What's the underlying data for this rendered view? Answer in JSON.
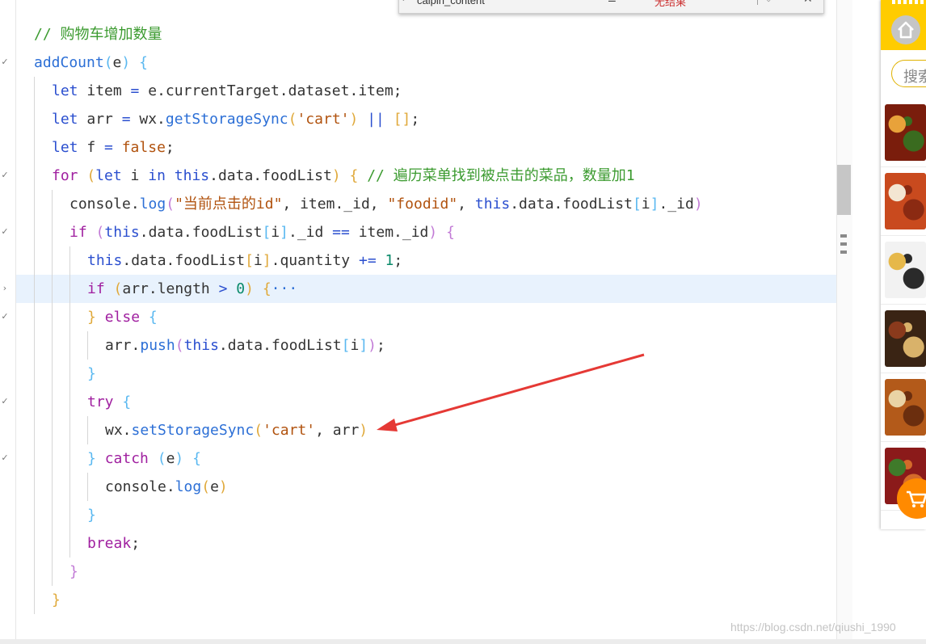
{
  "editor": {
    "find_widget": {
      "query": "caipin_content",
      "result": "无结果"
    },
    "lines": [
      [
        [
          "// 购物车增加数量",
          "cm"
        ]
      ],
      [
        [
          "addCount",
          "fn"
        ],
        [
          "(",
          "p1"
        ],
        [
          "e",
          "id"
        ],
        [
          ")",
          "p1"
        ],
        [
          " ",
          "id"
        ],
        [
          "{",
          "p1"
        ]
      ],
      [
        [
          "let",
          "kw"
        ],
        [
          " item ",
          "id"
        ],
        [
          "=",
          "op"
        ],
        [
          " e.currentTarget.dataset.item;",
          "id"
        ]
      ],
      [
        [
          "let",
          "kw"
        ],
        [
          " arr ",
          "id"
        ],
        [
          "=",
          "op"
        ],
        [
          " wx.",
          "id"
        ],
        [
          "getStorageSync",
          "fn"
        ],
        [
          "(",
          "p2"
        ],
        [
          "'cart'",
          "str"
        ],
        [
          ")",
          "p2"
        ],
        [
          " ",
          "id"
        ],
        [
          "||",
          "op"
        ],
        [
          " ",
          "id"
        ],
        [
          "[]",
          "p2"
        ],
        [
          ";",
          "id"
        ]
      ],
      [
        [
          "let",
          "kw"
        ],
        [
          " f ",
          "id"
        ],
        [
          "=",
          "op"
        ],
        [
          " ",
          "id"
        ],
        [
          "false",
          "str"
        ],
        [
          ";",
          "id"
        ]
      ],
      [
        [
          "for",
          "ctl"
        ],
        [
          " ",
          "id"
        ],
        [
          "(",
          "p2"
        ],
        [
          "let",
          "kw"
        ],
        [
          " i ",
          "id"
        ],
        [
          "in",
          "kw"
        ],
        [
          " ",
          "id"
        ],
        [
          "this",
          "this"
        ],
        [
          ".data.foodList",
          "id"
        ],
        [
          ")",
          "p2"
        ],
        [
          " ",
          "id"
        ],
        [
          "{",
          "p2"
        ],
        [
          " // 遍历菜单找到被点击的菜品，数量加1",
          "cm"
        ]
      ],
      [
        [
          "console.",
          "id"
        ],
        [
          "log",
          "fn"
        ],
        [
          "(",
          "p3"
        ],
        [
          "\"当前点击的id\"",
          "str"
        ],
        [
          ", item._id, ",
          "id"
        ],
        [
          "\"foodid\"",
          "str"
        ],
        [
          ", ",
          "id"
        ],
        [
          "this",
          "this"
        ],
        [
          ".data.foodList",
          "id"
        ],
        [
          "[",
          "p1"
        ],
        [
          "i",
          "id"
        ],
        [
          "]",
          "p1"
        ],
        [
          "._id",
          "id"
        ],
        [
          ")",
          "p3"
        ]
      ],
      [
        [
          "if",
          "ctl"
        ],
        [
          " ",
          "id"
        ],
        [
          "(",
          "p3"
        ],
        [
          "this",
          "this"
        ],
        [
          ".data.foodList",
          "id"
        ],
        [
          "[",
          "p1"
        ],
        [
          "i",
          "id"
        ],
        [
          "]",
          "p1"
        ],
        [
          "._id ",
          "id"
        ],
        [
          "==",
          "op"
        ],
        [
          " item._id",
          "id"
        ],
        [
          ")",
          "p3"
        ],
        [
          " ",
          "id"
        ],
        [
          "{",
          "p3"
        ]
      ],
      [
        [
          "this",
          "this"
        ],
        [
          ".data.foodList",
          "id"
        ],
        [
          "[",
          "p2"
        ],
        [
          "i",
          "id"
        ],
        [
          "]",
          "p2"
        ],
        [
          ".quantity ",
          "id"
        ],
        [
          "+=",
          "op"
        ],
        [
          " ",
          "id"
        ],
        [
          "1",
          "num"
        ],
        [
          ";",
          "id"
        ]
      ],
      [
        [
          "if",
          "ctl"
        ],
        [
          " ",
          "id"
        ],
        [
          "(",
          "p2"
        ],
        [
          "arr.length ",
          "id"
        ],
        [
          ">",
          "op"
        ],
        [
          " ",
          "id"
        ],
        [
          "0",
          "num"
        ],
        [
          ")",
          "p2"
        ],
        [
          " ",
          "id"
        ],
        [
          "{",
          "p2"
        ],
        [
          "···",
          "fold"
        ]
      ],
      [
        [
          "}",
          "p2"
        ],
        [
          " ",
          "id"
        ],
        [
          "else",
          "ctl"
        ],
        [
          " ",
          "id"
        ],
        [
          "{",
          "p1"
        ]
      ],
      [
        [
          "arr.",
          "id"
        ],
        [
          "push",
          "fn"
        ],
        [
          "(",
          "p3"
        ],
        [
          "this",
          "this"
        ],
        [
          ".data.foodList",
          "id"
        ],
        [
          "[",
          "p1"
        ],
        [
          "i",
          "id"
        ],
        [
          "]",
          "p1"
        ],
        [
          ")",
          "p3"
        ],
        [
          ";",
          "id"
        ]
      ],
      [
        [
          "}",
          "p1"
        ]
      ],
      [
        [
          "try",
          "ctl"
        ],
        [
          " ",
          "id"
        ],
        [
          "{",
          "p1"
        ]
      ],
      [
        [
          "wx.",
          "id"
        ],
        [
          "setStorageSync",
          "fn"
        ],
        [
          "(",
          "p2"
        ],
        [
          "'cart'",
          "str"
        ],
        [
          ", arr",
          "id"
        ],
        [
          ")",
          "p2"
        ]
      ],
      [
        [
          "}",
          "p1"
        ],
        [
          " ",
          "id"
        ],
        [
          "catch",
          "ctl"
        ],
        [
          " ",
          "id"
        ],
        [
          "(",
          "p1"
        ],
        [
          "e",
          "id"
        ],
        [
          ")",
          "p1"
        ],
        [
          " ",
          "id"
        ],
        [
          "{",
          "p1"
        ]
      ],
      [
        [
          "console.",
          "id"
        ],
        [
          "log",
          "fn"
        ],
        [
          "(",
          "p2"
        ],
        [
          "e",
          "id"
        ],
        [
          ")",
          "p2"
        ]
      ],
      [
        [
          "}",
          "p1"
        ]
      ],
      [
        [
          "break",
          "ctl"
        ],
        [
          ";",
          "id"
        ]
      ],
      [
        [
          "}",
          "p3"
        ]
      ],
      [
        [
          "}",
          "p2"
        ]
      ]
    ],
    "indent_levels": [
      0,
      0,
      1,
      1,
      1,
      1,
      2,
      2,
      3,
      3,
      3,
      4,
      3,
      3,
      4,
      3,
      4,
      3,
      3,
      2,
      1
    ],
    "folded_line_index": 9,
    "gutter_markers": [
      {
        "line_index": 1,
        "glyph": "✓"
      },
      {
        "line_index": 5,
        "glyph": "✓"
      },
      {
        "line_index": 7,
        "glyph": "✓"
      },
      {
        "line_index": 9,
        "glyph": "›"
      },
      {
        "line_index": 10,
        "glyph": "✓"
      },
      {
        "line_index": 13,
        "glyph": "✓"
      },
      {
        "line_index": 15,
        "glyph": "✓"
      }
    ],
    "colors": {
      "comment": "#3c9b30",
      "function": "#2c6fd6",
      "keyword": "#2b4fcf",
      "control": "#a020a0",
      "string": "#b1530f",
      "number": "#0a8a6a",
      "highlight": "#e8f2fd",
      "arrow": "#e53935"
    }
  },
  "annotation": {
    "arrow_target_line_index": 14
  },
  "watermark": "https://blog.csdn.net/qiushi_1990",
  "simulator": {
    "header_color": "#ffcc00",
    "home_icon": "home-icon",
    "search_label": "搜索",
    "food_thumbnails": [
      {
        "name": "food-thumbnail-1",
        "colors": [
          "#7a1d0c",
          "#e8a23a",
          "#3a6b1f"
        ]
      },
      {
        "name": "food-thumbnail-2",
        "colors": [
          "#c94a1e",
          "#f3e6d2",
          "#8b2a12"
        ]
      },
      {
        "name": "food-thumbnail-3",
        "colors": [
          "#f2f2f2",
          "#e6b84a",
          "#2a2a2a"
        ]
      },
      {
        "name": "food-thumbnail-4",
        "colors": [
          "#3a2414",
          "#8a3a1c",
          "#d9b26a"
        ]
      },
      {
        "name": "food-thumbnail-5",
        "colors": [
          "#b35a1a",
          "#e9d3a5",
          "#6b2e0e"
        ]
      },
      {
        "name": "food-thumbnail-6",
        "colors": [
          "#8b1a1a",
          "#3f7a2a",
          "#d46a2a"
        ]
      }
    ],
    "cart_icon": "cart-icon",
    "cart_color": "#ff8a00"
  }
}
